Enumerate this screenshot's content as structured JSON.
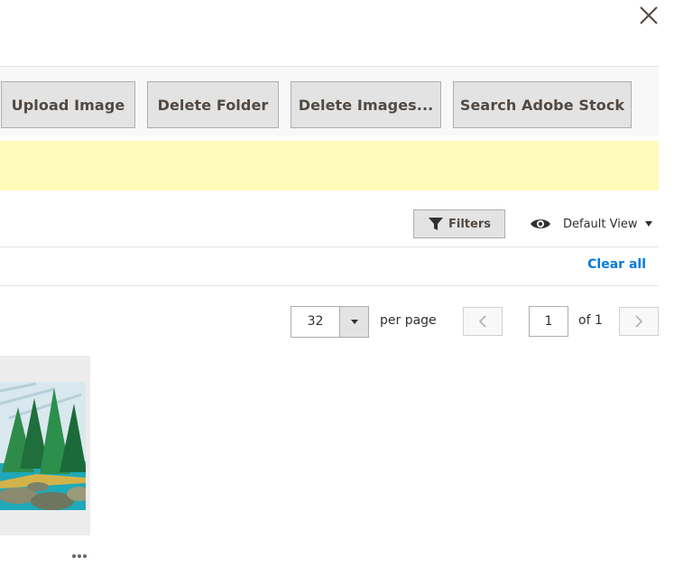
{
  "header": {
    "close_icon": "close-icon"
  },
  "toolbar": {
    "upload_label": "Upload Image",
    "delete_folder_label": "Delete Folder",
    "delete_images_label": "Delete Images...",
    "search_stock_label": "Search Adobe Stock"
  },
  "notice": {
    "color": "#fffbbb"
  },
  "controls": {
    "filters_label": "Filters",
    "filters_icon": "funnel-icon",
    "view_icon": "eye-icon",
    "view_label": "Default View",
    "clear_all_label": "Clear all"
  },
  "pagination": {
    "per_page_value": "32",
    "per_page_label": "per page",
    "current_page": "1",
    "total_label": "of 1"
  },
  "grid": {
    "items": [
      {
        "kind": "image",
        "subject": "painted forest lake landscape"
      }
    ],
    "more_icon": "ellipsis-icon"
  },
  "colors": {
    "button_bg": "#e3e3e3",
    "button_text": "#514943",
    "link": "#007bdb",
    "toolbar_bg": "#f8f8f8"
  }
}
